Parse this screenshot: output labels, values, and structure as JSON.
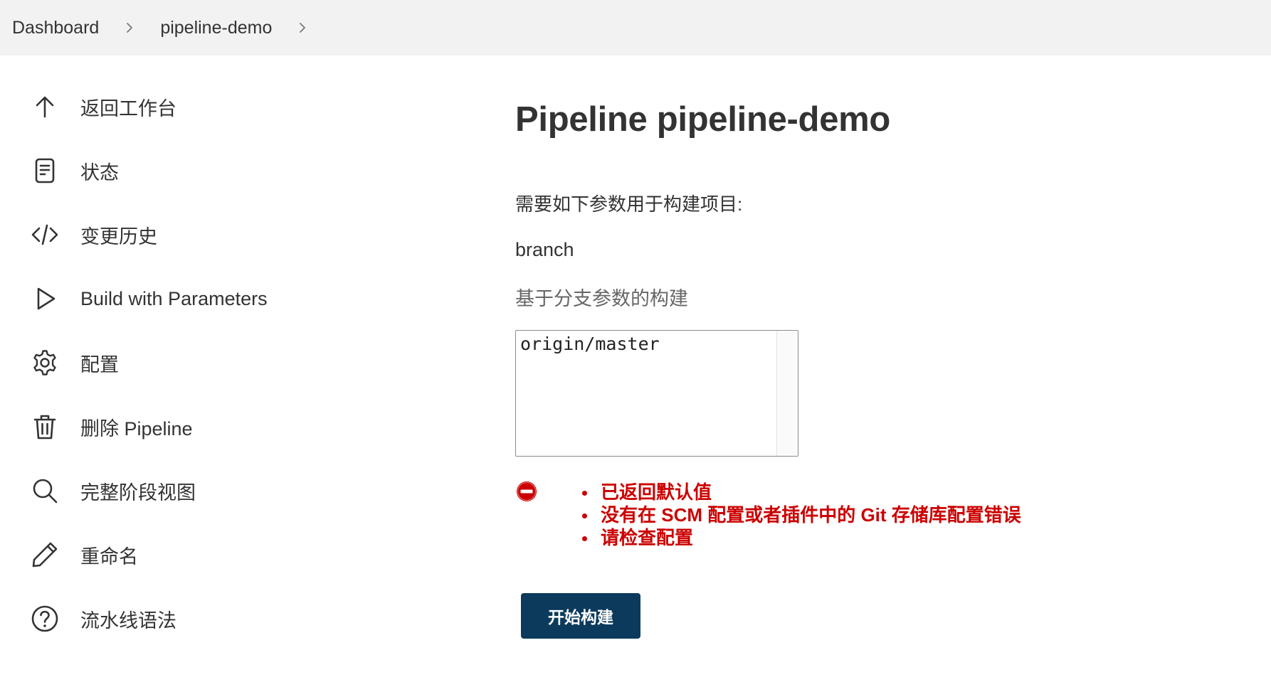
{
  "breadcrumb": {
    "items": [
      "Dashboard",
      "pipeline-demo"
    ]
  },
  "sidebar": {
    "items": [
      {
        "label": "返回工作台",
        "icon": "arrow-up-icon"
      },
      {
        "label": "状态",
        "icon": "document-icon"
      },
      {
        "label": "变更历史",
        "icon": "code-icon"
      },
      {
        "label": "Build with Parameters",
        "icon": "play-icon"
      },
      {
        "label": "配置",
        "icon": "gear-icon"
      },
      {
        "label": "删除 Pipeline",
        "icon": "trash-icon"
      },
      {
        "label": "完整阶段视图",
        "icon": "search-icon"
      },
      {
        "label": "重命名",
        "icon": "pencil-icon"
      },
      {
        "label": "流水线语法",
        "icon": "help-icon"
      }
    ]
  },
  "main": {
    "title": "Pipeline pipeline-demo",
    "intro": "需要如下参数用于构建项目:",
    "parameter": {
      "name": "branch",
      "description": "基于分支参数的构建",
      "value": "origin/master"
    },
    "errors": [
      "已返回默认值",
      "没有在 SCM 配置或者插件中的 Git 存储库配置错误",
      "请检查配置"
    ],
    "build_button": "开始构建"
  },
  "colors": {
    "breadcrumb_bg": "#f2f2f2",
    "error": "#cc0000",
    "button_bg": "#0b3a5c"
  }
}
